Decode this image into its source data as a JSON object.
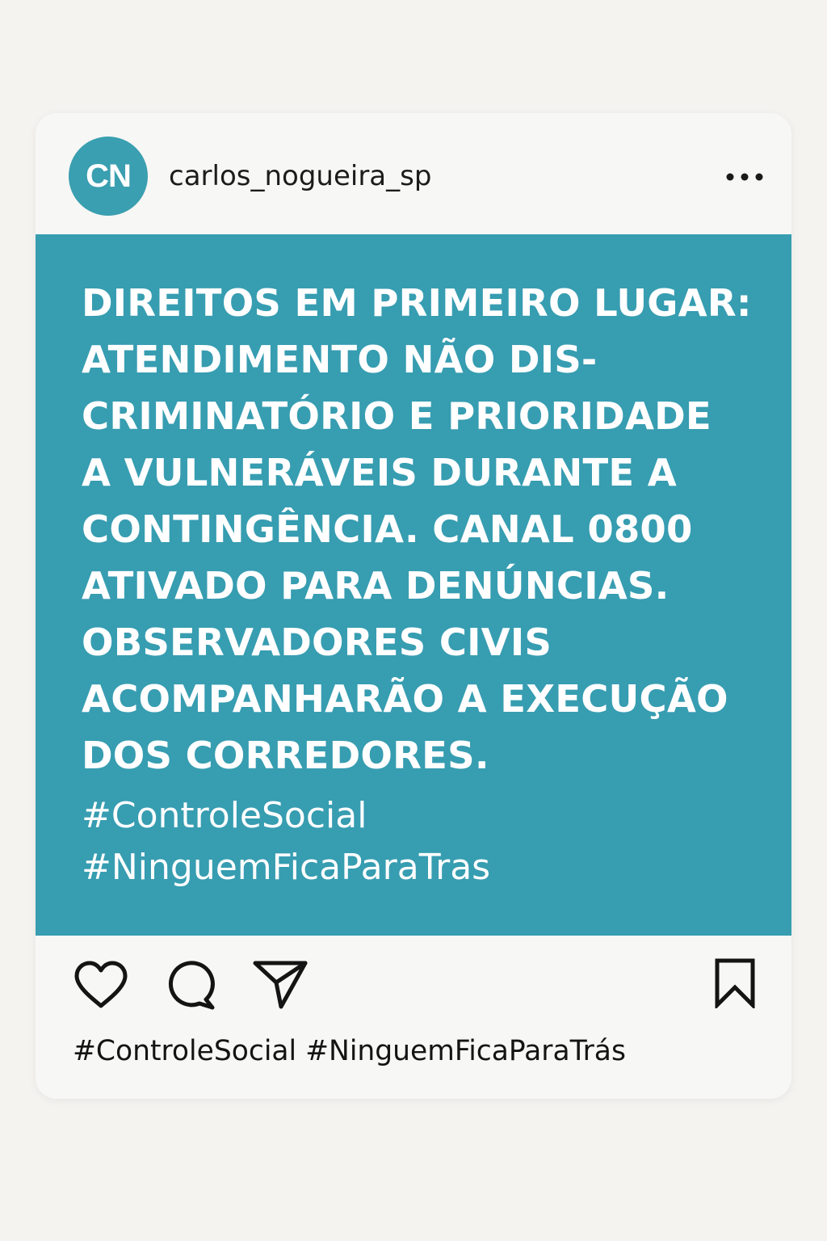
{
  "post": {
    "avatar_initials": "CN",
    "username": "carlos_nogueira_sp",
    "headline": "DIREITOS EM PRIMEIRO LUGAR:\nATENDIMENTO NÃO DIS-\nCRIMINATÓRIO E PRIORIDADE\nA VULNERÁVEIS DURANTE A\nCONTINGÊNCIA. CANAL 0800\nATIVADO PARA DENÚNCIAS.\nOBSERVADORES CIVIS\nACOMPANHARÃO A EXECUÇÃO\nDOS CORREDORES.",
    "image_hashtags": [
      "#ControleSocial",
      "#NinguemFicaParaTras"
    ],
    "caption_hashtags": [
      "#ControleSocial",
      "#NinguemFicaParaTrás"
    ]
  },
  "icons": {
    "more": "more-horizontal-icon",
    "like": "heart-icon",
    "comment": "comment-icon",
    "share": "paper-plane-icon",
    "save": "bookmark-icon"
  },
  "colors": {
    "accent": "#379db1",
    "avatar": "#3a9fb0",
    "background": "#f4f3f0",
    "card": "#f7f7f5",
    "text": "#1c1c1c"
  }
}
